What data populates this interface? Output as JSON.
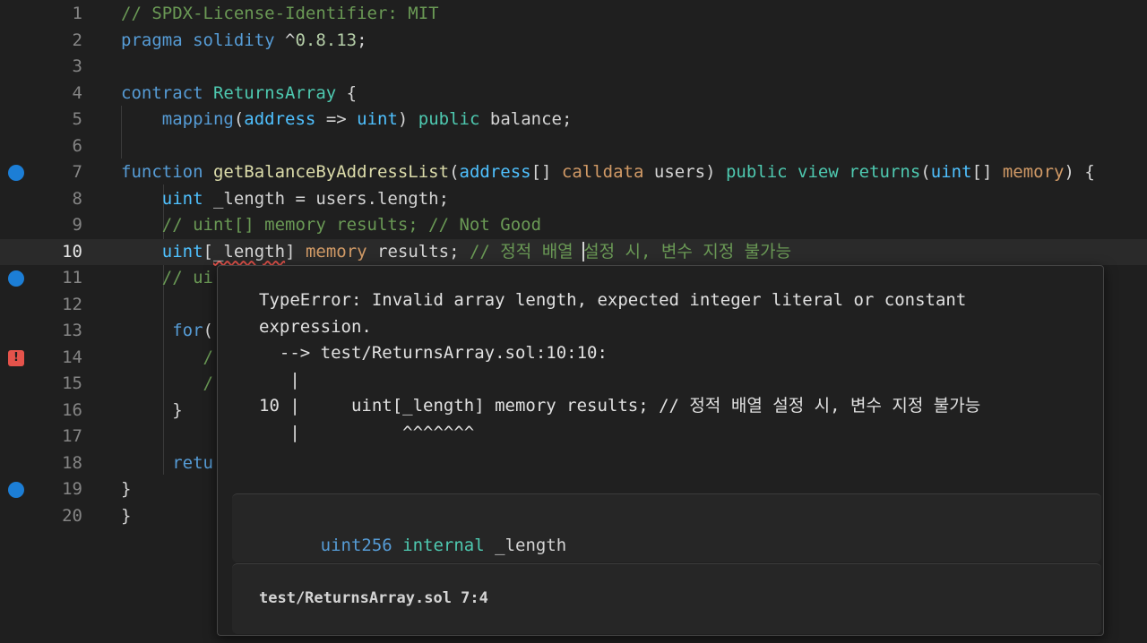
{
  "editor": {
    "active_line": "10",
    "lines": [
      {
        "n": "1",
        "tokens": [
          [
            "c-com",
            "// SPDX-License-Identifier: MIT"
          ]
        ]
      },
      {
        "n": "2",
        "tokens": [
          [
            "c-kw",
            "pragma "
          ],
          [
            "c-kw",
            "solidity "
          ],
          [
            "c-txt",
            "^"
          ],
          [
            "c-num",
            "0.8.13"
          ],
          [
            "c-txt",
            ";"
          ]
        ]
      },
      {
        "n": "3",
        "tokens": []
      },
      {
        "n": "4",
        "tokens": [
          [
            "c-kw",
            "contract "
          ],
          [
            "c-teal",
            "ReturnsArray "
          ],
          [
            "c-txt",
            "{"
          ]
        ]
      },
      {
        "n": "5",
        "tokens": [
          [
            "c-txt",
            "    "
          ],
          [
            "c-kw",
            "mapping"
          ],
          [
            "c-txt",
            "("
          ],
          [
            "c-type",
            "address"
          ],
          [
            "c-txt",
            " => "
          ],
          [
            "c-type",
            "uint"
          ],
          [
            "c-txt",
            ") "
          ],
          [
            "c-teal",
            "public "
          ],
          [
            "c-txt",
            "balance;"
          ]
        ]
      },
      {
        "n": "6",
        "tokens": []
      },
      {
        "n": "7",
        "tokens": [
          [
            "c-kw",
            "function "
          ],
          [
            "c-fn",
            "getBalanceByAddressList"
          ],
          [
            "c-txt",
            "("
          ],
          [
            "c-type",
            "address"
          ],
          [
            "c-txt",
            "[] "
          ],
          [
            "c-amb",
            "calldata "
          ],
          [
            "c-txt",
            "users) "
          ],
          [
            "c-teal",
            "public view returns"
          ],
          [
            "c-txt",
            "("
          ],
          [
            "c-type",
            "uint"
          ],
          [
            "c-txt",
            "[] "
          ],
          [
            "c-amb",
            "memory"
          ],
          [
            "c-txt",
            ") {"
          ]
        ]
      },
      {
        "n": "8",
        "tokens": [
          [
            "c-txt",
            "    "
          ],
          [
            "c-type",
            "uint "
          ],
          [
            "c-txt",
            "_length = users.length;"
          ]
        ]
      },
      {
        "n": "9",
        "tokens": [
          [
            "c-txt",
            "    "
          ],
          [
            "c-com",
            "// uint[] memory results; // Not Good"
          ]
        ]
      },
      {
        "n": "10",
        "tokens": [
          [
            "c-txt",
            "    "
          ],
          [
            "c-type",
            "uint"
          ],
          [
            "c-txt",
            "["
          ],
          [
            "squig",
            "_length"
          ],
          [
            "c-txt",
            "] "
          ],
          [
            "c-amb",
            "memory "
          ],
          [
            "c-txt",
            "results; "
          ],
          [
            "c-com",
            "// 정적 배열 "
          ],
          [
            "cursor",
            ""
          ],
          [
            "c-com",
            "설정 시, 변수 지정 불가능"
          ]
        ]
      },
      {
        "n": "11",
        "tokens": [
          [
            "c-txt",
            "    "
          ],
          [
            "c-com",
            "// ui"
          ]
        ]
      },
      {
        "n": "12",
        "tokens": []
      },
      {
        "n": "13",
        "tokens": [
          [
            "c-txt",
            "     "
          ],
          [
            "c-kw",
            "for"
          ],
          [
            "c-txt",
            "("
          ]
        ]
      },
      {
        "n": "14",
        "tokens": [
          [
            "c-txt",
            "        "
          ],
          [
            "c-com",
            "/"
          ]
        ]
      },
      {
        "n": "15",
        "tokens": [
          [
            "c-txt",
            "        "
          ],
          [
            "c-com",
            "/"
          ]
        ]
      },
      {
        "n": "16",
        "tokens": [
          [
            "c-txt",
            "     }"
          ]
        ]
      },
      {
        "n": "17",
        "tokens": []
      },
      {
        "n": "18",
        "tokens": [
          [
            "c-txt",
            "     "
          ],
          [
            "c-kw",
            "retu"
          ]
        ]
      },
      {
        "n": "19",
        "tokens": [
          [
            "c-txt",
            "}"
          ]
        ]
      },
      {
        "n": "20",
        "tokens": [
          [
            "c-txt",
            "}"
          ]
        ]
      }
    ],
    "gutter_markers": {
      "7": "breakpoint",
      "11": "breakpoint",
      "14": "error",
      "19": "breakpoint"
    }
  },
  "hover": {
    "error_lines": [
      "TypeError: Invalid array length, expected integer literal or constant",
      "expression.",
      "  --> test/ReturnsArray.sol:10:10:",
      "   |",
      "10 |     uint[_length] memory results; // 정적 배열 설정 시, 변수 지정 불가능",
      "   |          ^^^^^^^"
    ],
    "symbol_type": "uint256",
    "symbol_visibility": "internal",
    "symbol_name": "_length",
    "location": "test/ReturnsArray.sol 7:4"
  },
  "colors": {
    "background": "#1f1f1f",
    "breakpoint": "#1c7ed6",
    "error": "#e5534b"
  }
}
